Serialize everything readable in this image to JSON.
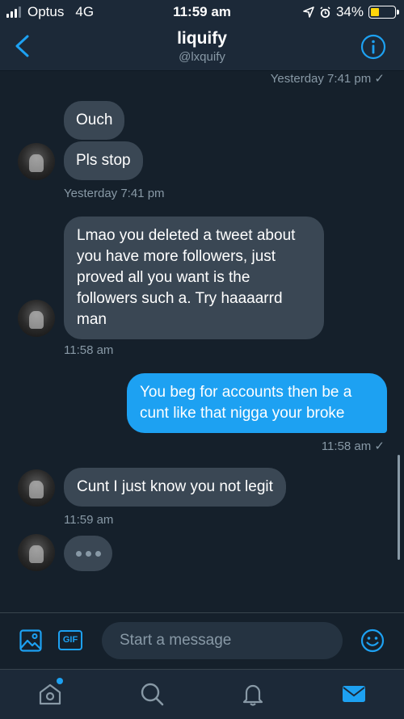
{
  "status_bar": {
    "carrier": "Optus",
    "network": "4G",
    "time": "11:59 am",
    "battery": "34%",
    "battery_level": 0.34
  },
  "header": {
    "name": "liquify",
    "handle": "@lxquify"
  },
  "messages": [
    {
      "type": "timestamp",
      "text": "Yesterday 7:41 pm ✓"
    },
    {
      "type": "received",
      "text": "Ouch"
    },
    {
      "type": "received",
      "text": "Pls stop"
    },
    {
      "type": "timestamp",
      "text": "Yesterday 7:41 pm"
    },
    {
      "type": "received",
      "text": "Lmao you deleted a tweet about you have more followers, just proved all you want is the followers such a. Try haaaarrd man"
    },
    {
      "type": "timestamp",
      "text": "11:58 am"
    },
    {
      "type": "sent",
      "text": "You beg for accounts then be a cunt like that nigga your broke"
    },
    {
      "type": "timestamp",
      "text": "11:58 am ✓"
    },
    {
      "type": "received",
      "text": "Cunt I just know you not legit"
    },
    {
      "type": "timestamp",
      "text": "11:59 am"
    }
  ],
  "composer": {
    "placeholder": "Start a message",
    "gif_label": "GIF"
  },
  "tabs": [
    "home-icon",
    "search-icon",
    "bell-icon",
    "mail-icon"
  ],
  "colors": {
    "background": "#15202b",
    "bubble_received": "#3a4754",
    "bubble_sent": "#1da1f2",
    "accent": "#1da1f2",
    "muted_text": "#8899a6"
  }
}
